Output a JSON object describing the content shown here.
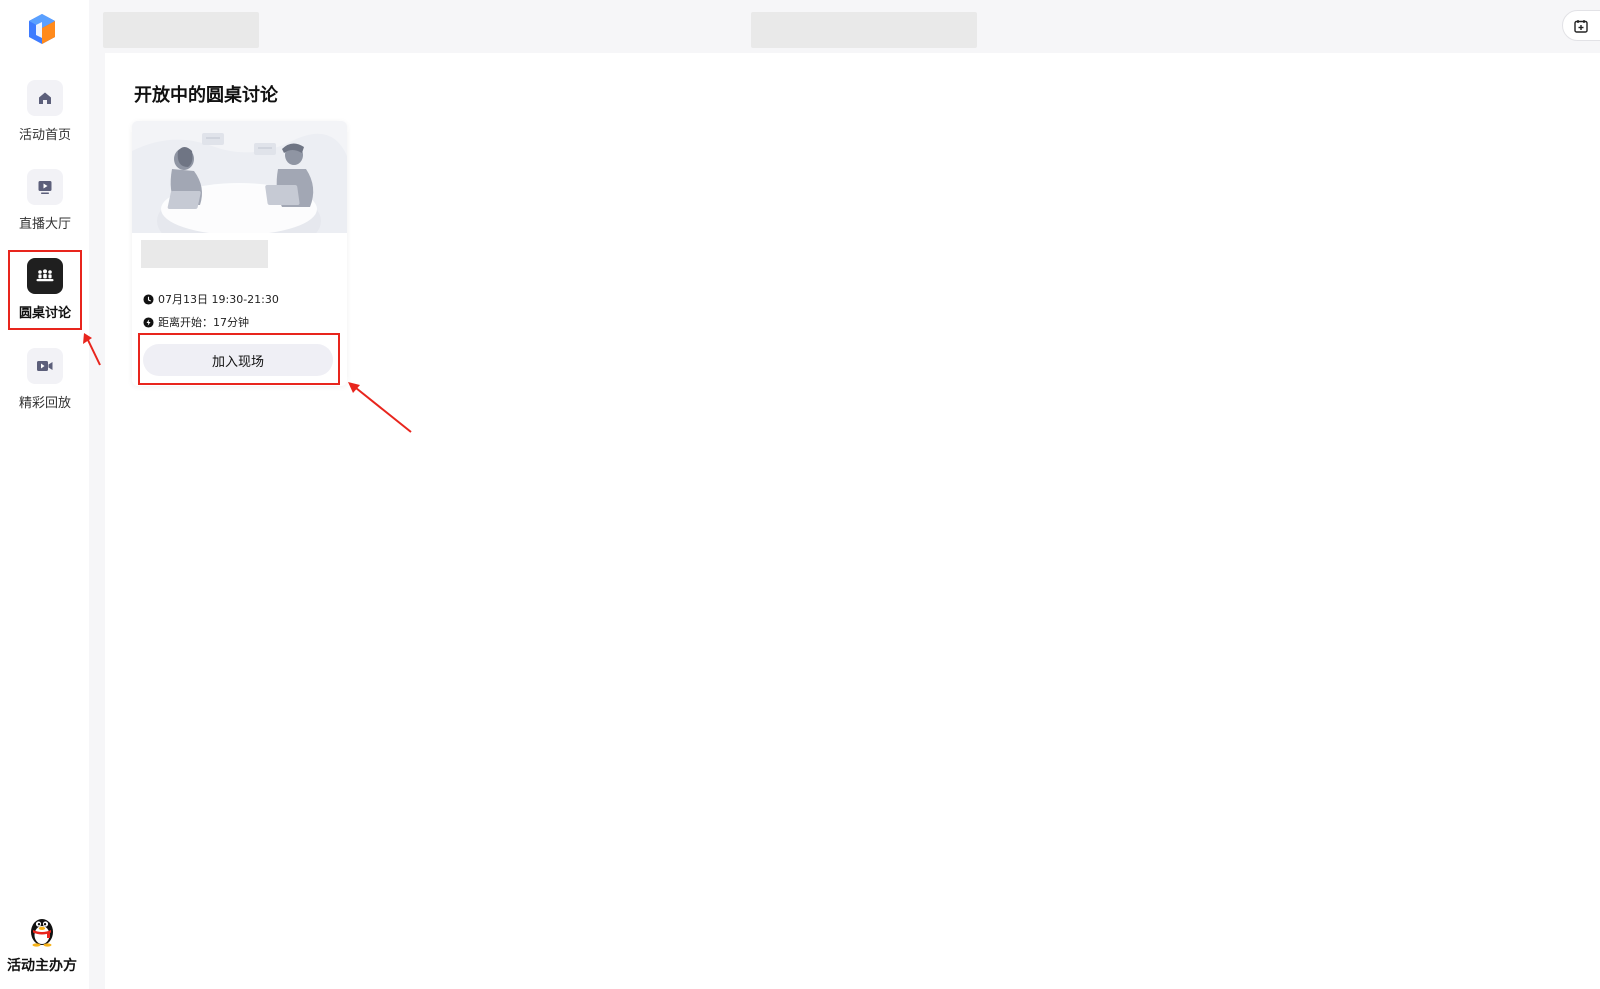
{
  "sidebar": {
    "items": [
      {
        "label": "活动首页",
        "icon": "home-icon",
        "active": false
      },
      {
        "label": "直播大厅",
        "icon": "live-play-icon",
        "active": false
      },
      {
        "label": "圆桌讨论",
        "icon": "roundtable-group-icon",
        "active": true
      },
      {
        "label": "精彩回放",
        "icon": "video-camera-icon",
        "active": false
      }
    ],
    "organizer_label": "活动主办方"
  },
  "main": {
    "section_title": "开放中的圆桌讨论",
    "card": {
      "time": "07月13日 19:30-21:30",
      "countdown": "距离开始：17分钟",
      "join_label": "加入现场"
    }
  },
  "colors": {
    "highlight_red": "#e8251d",
    "active_nav_bg": "#1f1f1f",
    "nav_icon_bg": "#f2f2f6",
    "join_button_bg": "#efeff5",
    "topbar_bg": "#f6f6f8",
    "placeholder_gray": "#e9e9e9"
  }
}
